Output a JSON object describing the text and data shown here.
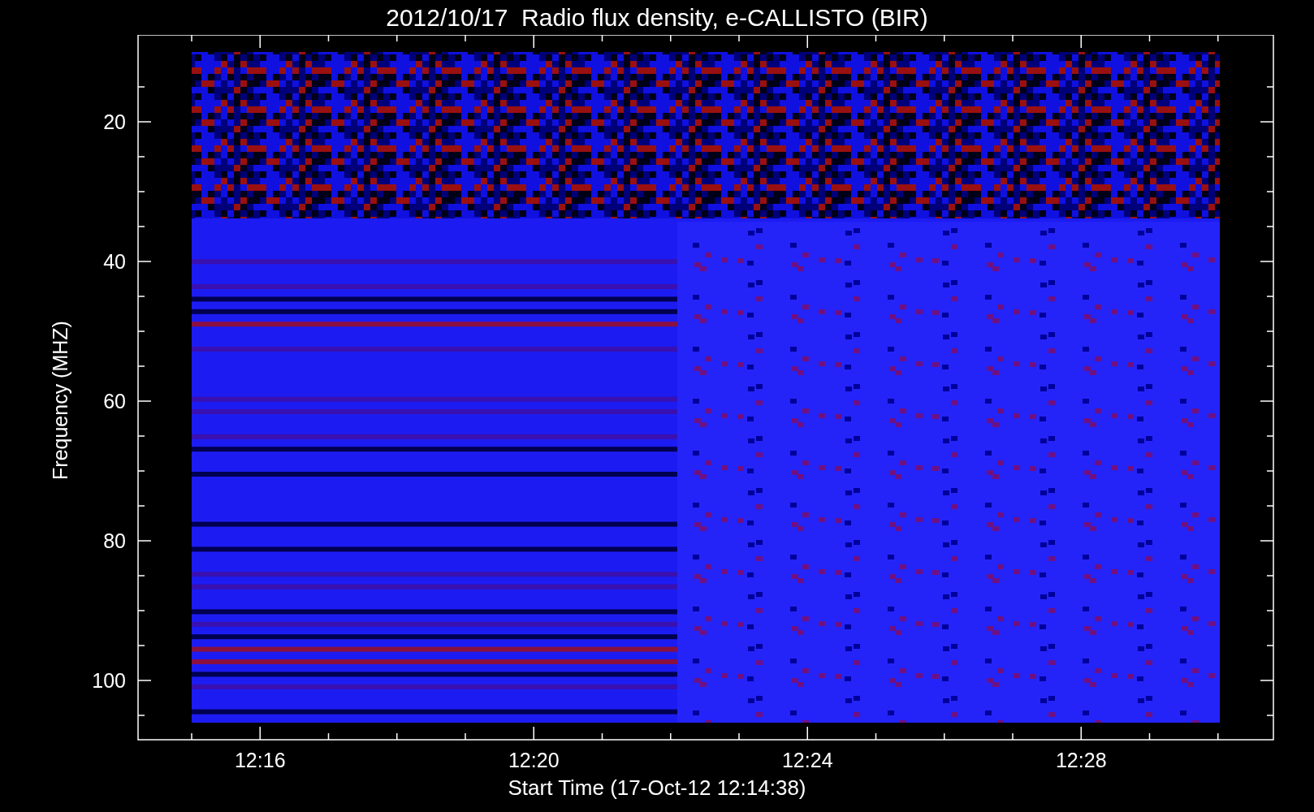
{
  "title": "2012/10/17  Radio flux density, e-CALLISTO (BIR)",
  "y_axis": {
    "label": "Frequency (MHZ)",
    "ticks": [
      "20",
      "40",
      "60",
      "80",
      "100"
    ]
  },
  "x_axis": {
    "label": "Start Time (17-Oct-12 12:14:38)",
    "ticks": [
      "12:16",
      "12:20",
      "12:24",
      "12:28"
    ]
  }
}
